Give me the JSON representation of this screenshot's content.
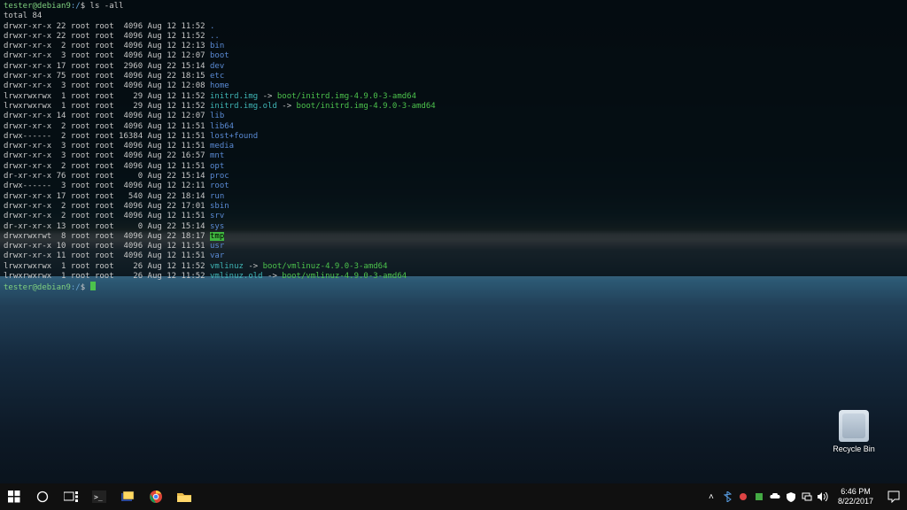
{
  "prompt": {
    "user": "tester@debian9",
    "path": ":/",
    "sym": "$"
  },
  "command": "ls -all",
  "total_line": "total 84",
  "ls": [
    {
      "perm": "drwxr-xr-x",
      "n": "22",
      "o": "root",
      "g": "root",
      "sz": "4096",
      "dt": "Aug 12 11:52",
      "name": ".",
      "cls": "c-blue"
    },
    {
      "perm": "drwxr-xr-x",
      "n": "22",
      "o": "root",
      "g": "root",
      "sz": "4096",
      "dt": "Aug 12 11:52",
      "name": "..",
      "cls": "c-blue"
    },
    {
      "perm": "drwxr-xr-x",
      "n": "2",
      "o": "root",
      "g": "root",
      "sz": "4096",
      "dt": "Aug 12 12:13",
      "name": "bin",
      "cls": "c-blue"
    },
    {
      "perm": "drwxr-xr-x",
      "n": "3",
      "o": "root",
      "g": "root",
      "sz": "4096",
      "dt": "Aug 12 12:07",
      "name": "boot",
      "cls": "c-blue"
    },
    {
      "perm": "drwxr-xr-x",
      "n": "17",
      "o": "root",
      "g": "root",
      "sz": "2960",
      "dt": "Aug 22 15:14",
      "name": "dev",
      "cls": "c-blue"
    },
    {
      "perm": "drwxr-xr-x",
      "n": "75",
      "o": "root",
      "g": "root",
      "sz": "4096",
      "dt": "Aug 22 18:15",
      "name": "etc",
      "cls": "c-blue"
    },
    {
      "perm": "drwxr-xr-x",
      "n": "3",
      "o": "root",
      "g": "root",
      "sz": "4096",
      "dt": "Aug 12 12:08",
      "name": "home",
      "cls": "c-blue"
    },
    {
      "perm": "lrwxrwxrwx",
      "n": "1",
      "o": "root",
      "g": "root",
      "sz": "29",
      "dt": "Aug 12 11:52",
      "name": "initrd.img",
      "cls": "c-cyan",
      "arrow": " -> ",
      "tgt": "boot/initrd.img-4.9.0-3-amd64"
    },
    {
      "perm": "lrwxrwxrwx",
      "n": "1",
      "o": "root",
      "g": "root",
      "sz": "29",
      "dt": "Aug 12 11:52",
      "name": "initrd.img.old",
      "cls": "c-cyan",
      "arrow": " -> ",
      "tgt": "boot/initrd.img-4.9.0-3-amd64"
    },
    {
      "perm": "drwxr-xr-x",
      "n": "14",
      "o": "root",
      "g": "root",
      "sz": "4096",
      "dt": "Aug 12 12:07",
      "name": "lib",
      "cls": "c-blue"
    },
    {
      "perm": "drwxr-xr-x",
      "n": "2",
      "o": "root",
      "g": "root",
      "sz": "4096",
      "dt": "Aug 12 11:51",
      "name": "lib64",
      "cls": "c-blue"
    },
    {
      "perm": "drwx------",
      "n": "2",
      "o": "root",
      "g": "root",
      "sz": "16384",
      "dt": "Aug 12 11:51",
      "name": "lost+found",
      "cls": "c-blue"
    },
    {
      "perm": "drwxr-xr-x",
      "n": "3",
      "o": "root",
      "g": "root",
      "sz": "4096",
      "dt": "Aug 12 11:51",
      "name": "media",
      "cls": "c-blue"
    },
    {
      "perm": "drwxr-xr-x",
      "n": "3",
      "o": "root",
      "g": "root",
      "sz": "4096",
      "dt": "Aug 22 16:57",
      "name": "mnt",
      "cls": "c-blue"
    },
    {
      "perm": "drwxr-xr-x",
      "n": "2",
      "o": "root",
      "g": "root",
      "sz": "4096",
      "dt": "Aug 12 11:51",
      "name": "opt",
      "cls": "c-blue"
    },
    {
      "perm": "dr-xr-xr-x",
      "n": "76",
      "o": "root",
      "g": "root",
      "sz": "0",
      "dt": "Aug 22 15:14",
      "name": "proc",
      "cls": "c-blue"
    },
    {
      "perm": "drwx------",
      "n": "3",
      "o": "root",
      "g": "root",
      "sz": "4096",
      "dt": "Aug 12 12:11",
      "name": "root",
      "cls": "c-blue"
    },
    {
      "perm": "drwxr-xr-x",
      "n": "17",
      "o": "root",
      "g": "root",
      "sz": "540",
      "dt": "Aug 22 18:14",
      "name": "run",
      "cls": "c-blue"
    },
    {
      "perm": "drwxr-xr-x",
      "n": "2",
      "o": "root",
      "g": "root",
      "sz": "4096",
      "dt": "Aug 22 17:01",
      "name": "sbin",
      "cls": "c-blue"
    },
    {
      "perm": "drwxr-xr-x",
      "n": "2",
      "o": "root",
      "g": "root",
      "sz": "4096",
      "dt": "Aug 12 11:51",
      "name": "srv",
      "cls": "c-blue"
    },
    {
      "perm": "dr-xr-xr-x",
      "n": "13",
      "o": "root",
      "g": "root",
      "sz": "0",
      "dt": "Aug 22 15:14",
      "name": "sys",
      "cls": "c-blue"
    },
    {
      "perm": "drwxrwxrwt",
      "n": "8",
      "o": "root",
      "g": "root",
      "sz": "4096",
      "dt": "Aug 22 18:17",
      "name": "tmp",
      "cls": "c-hl"
    },
    {
      "perm": "drwxr-xr-x",
      "n": "10",
      "o": "root",
      "g": "root",
      "sz": "4096",
      "dt": "Aug 12 11:51",
      "name": "usr",
      "cls": "c-blue"
    },
    {
      "perm": "drwxr-xr-x",
      "n": "11",
      "o": "root",
      "g": "root",
      "sz": "4096",
      "dt": "Aug 12 11:51",
      "name": "var",
      "cls": "c-blue"
    },
    {
      "perm": "lrwxrwxrwx",
      "n": "1",
      "o": "root",
      "g": "root",
      "sz": "26",
      "dt": "Aug 12 11:52",
      "name": "vmlinuz",
      "cls": "c-cyan",
      "arrow": " -> ",
      "tgt": "boot/vmlinuz-4.9.0-3-amd64"
    },
    {
      "perm": "lrwxrwxrwx",
      "n": "1",
      "o": "root",
      "g": "root",
      "sz": "26",
      "dt": "Aug 12 11:52",
      "name": "vmlinuz.old",
      "cls": "c-cyan",
      "arrow": " -> ",
      "tgt": "boot/vmlinuz-4.9.0-3-amd64"
    }
  ],
  "recycle_label": "Recycle Bin",
  "tray_chevron": "˄",
  "clock": {
    "time": "6:46 PM",
    "date": "8/22/2017"
  }
}
